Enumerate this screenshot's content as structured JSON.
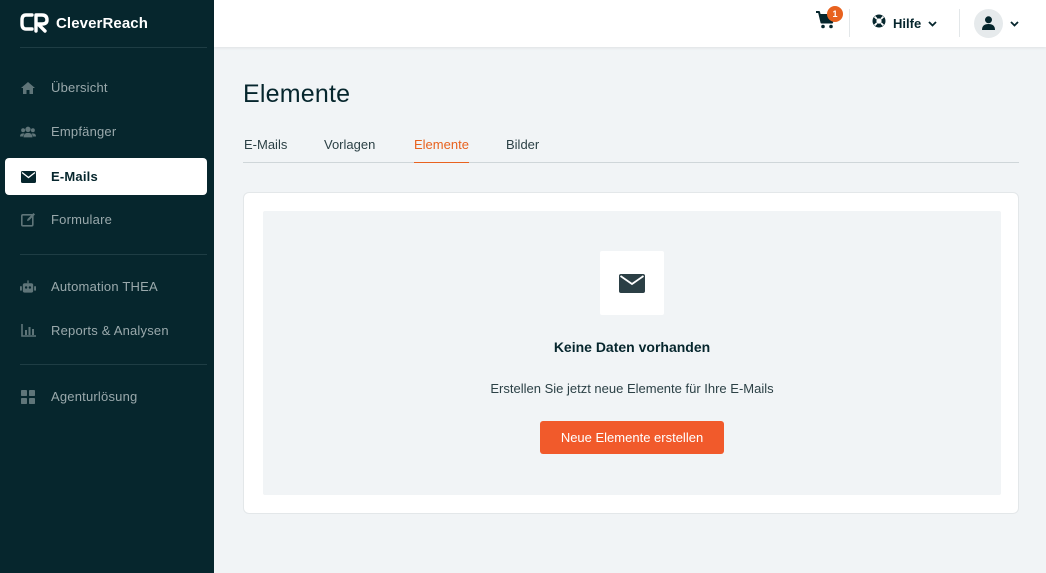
{
  "brand": {
    "name": "CleverReach",
    "accent": "#e8621f",
    "sidebar_bg": "#06262d"
  },
  "sidebar": {
    "items": [
      {
        "label": "Übersicht",
        "icon": "home-icon",
        "active": false
      },
      {
        "label": "Empfänger",
        "icon": "users-icon",
        "active": false
      },
      {
        "label": "E-Mails",
        "icon": "envelope-icon",
        "active": true
      },
      {
        "label": "Formulare",
        "icon": "edit-icon",
        "active": false
      },
      {
        "label": "Automation THEA",
        "icon": "robot-icon",
        "active": false
      },
      {
        "label": "Reports & Analysen",
        "icon": "chart-icon",
        "active": false
      },
      {
        "label": "Agenturlösung",
        "icon": "grid-icon",
        "active": false
      }
    ]
  },
  "topbar": {
    "cart_count": "1",
    "help_label": "Hilfe"
  },
  "page": {
    "title": "Elemente",
    "tabs": [
      {
        "label": "E-Mails",
        "active": false
      },
      {
        "label": "Vorlagen",
        "active": false
      },
      {
        "label": "Elemente",
        "active": true
      },
      {
        "label": "Bilder",
        "active": false
      }
    ]
  },
  "empty_state": {
    "icon": "envelope-icon",
    "title": "Keine Daten vorhanden",
    "subtitle": "Erstellen Sie jetzt neue Elemente für Ihre E-Mails",
    "button_label": "Neue Elemente erstellen"
  }
}
